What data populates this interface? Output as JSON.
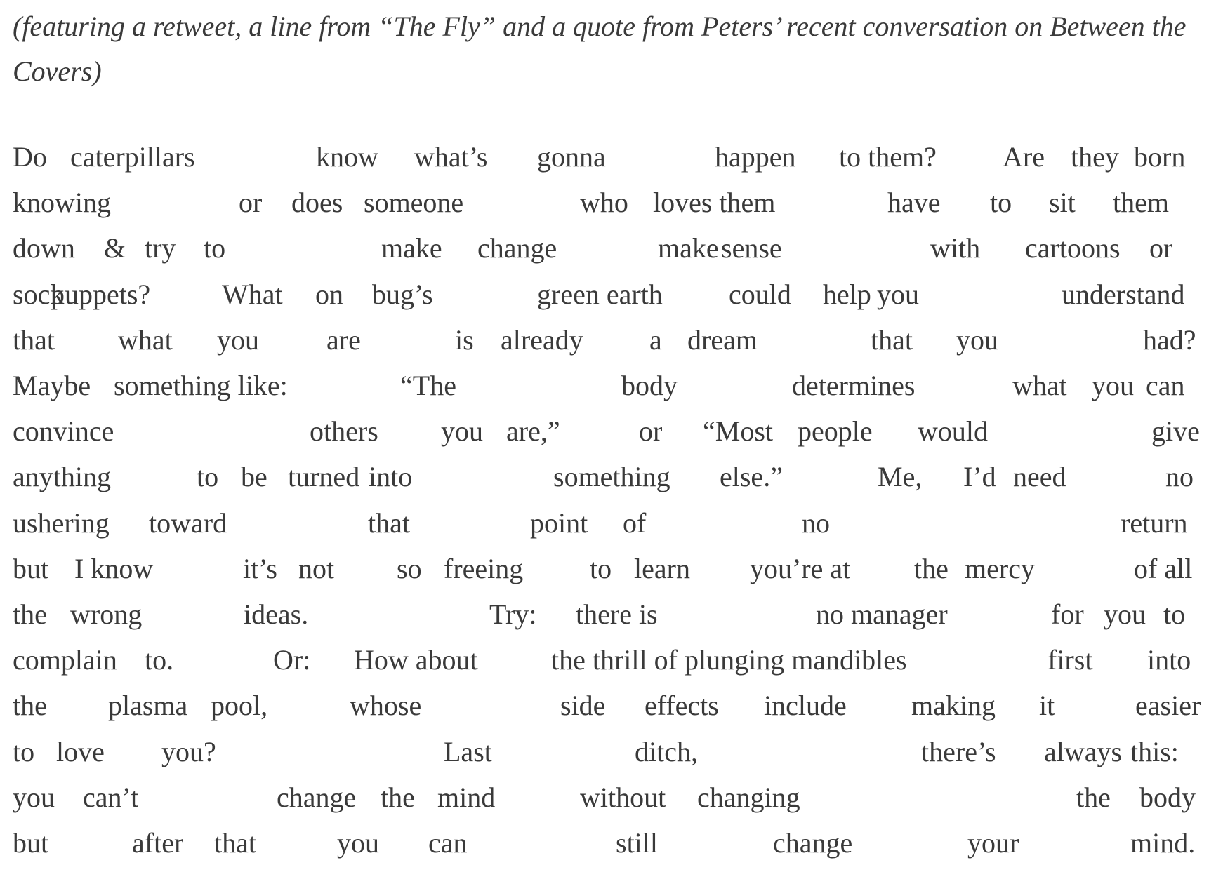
{
  "subtitle": "(featuring a retweet, a line from “The Fly” and a quote from Peters’ recent conversation on Between the Covers)",
  "poem": [
    [
      "Do",
      "caterpillars",
      "know",
      "what’s",
      "gonna",
      "happen",
      "to them?",
      "Are",
      "they",
      "born"
    ],
    [
      "knowing",
      "or",
      "does",
      "someone",
      "who",
      "loves them",
      "have",
      "to",
      "sit",
      "them"
    ],
    [
      "down",
      "&",
      "try",
      "to",
      "make",
      "change",
      "make",
      "sense",
      "with",
      "cartoons",
      "or"
    ],
    [
      "sock",
      "puppets?",
      "What",
      "on",
      "bug’s",
      "green earth",
      "could",
      "help",
      "you",
      "understand"
    ],
    [
      "that",
      "what",
      "you",
      "are",
      "is",
      "already",
      "a",
      "dream",
      "that",
      "you",
      "had?"
    ],
    [
      "Maybe",
      "something like:",
      "“The",
      "body",
      "determines",
      "what",
      "you",
      "can"
    ],
    [
      "convince",
      "others",
      "you",
      "are,”",
      "or",
      "“Most",
      "people",
      "would",
      "give"
    ],
    [
      "anything",
      "to",
      "be",
      "turned",
      "into",
      "something",
      "else.”",
      "Me,",
      "I’d",
      "need",
      "no"
    ],
    [
      "ushering",
      "toward",
      "that",
      "point",
      "of",
      "no",
      "return"
    ],
    [
      "but",
      "I know",
      "it’s",
      "not",
      "so",
      "freeing",
      "to",
      "learn",
      "you’re at",
      "the",
      "mercy",
      "of all"
    ],
    [
      "the",
      "wrong",
      "ideas.",
      "Try:",
      "there is",
      "no manager",
      "for",
      "you",
      "to"
    ],
    [
      "complain",
      "to.",
      "Or:",
      "How about",
      "the thrill of plunging mandibles",
      "first",
      "into"
    ],
    [
      "the",
      "plasma",
      "pool,",
      "whose",
      "side",
      "effects",
      "include",
      "making",
      "it",
      "easier"
    ],
    [
      "to",
      "love",
      "you?",
      "Last",
      "ditch,",
      "there’s",
      "always",
      "this:"
    ],
    [
      "you",
      "can’t",
      "change",
      "the",
      "mind",
      "without",
      "changing",
      "the",
      "body"
    ],
    [
      "but",
      "after",
      "that",
      "you",
      "can",
      "still",
      "change",
      "your",
      "mind."
    ]
  ]
}
